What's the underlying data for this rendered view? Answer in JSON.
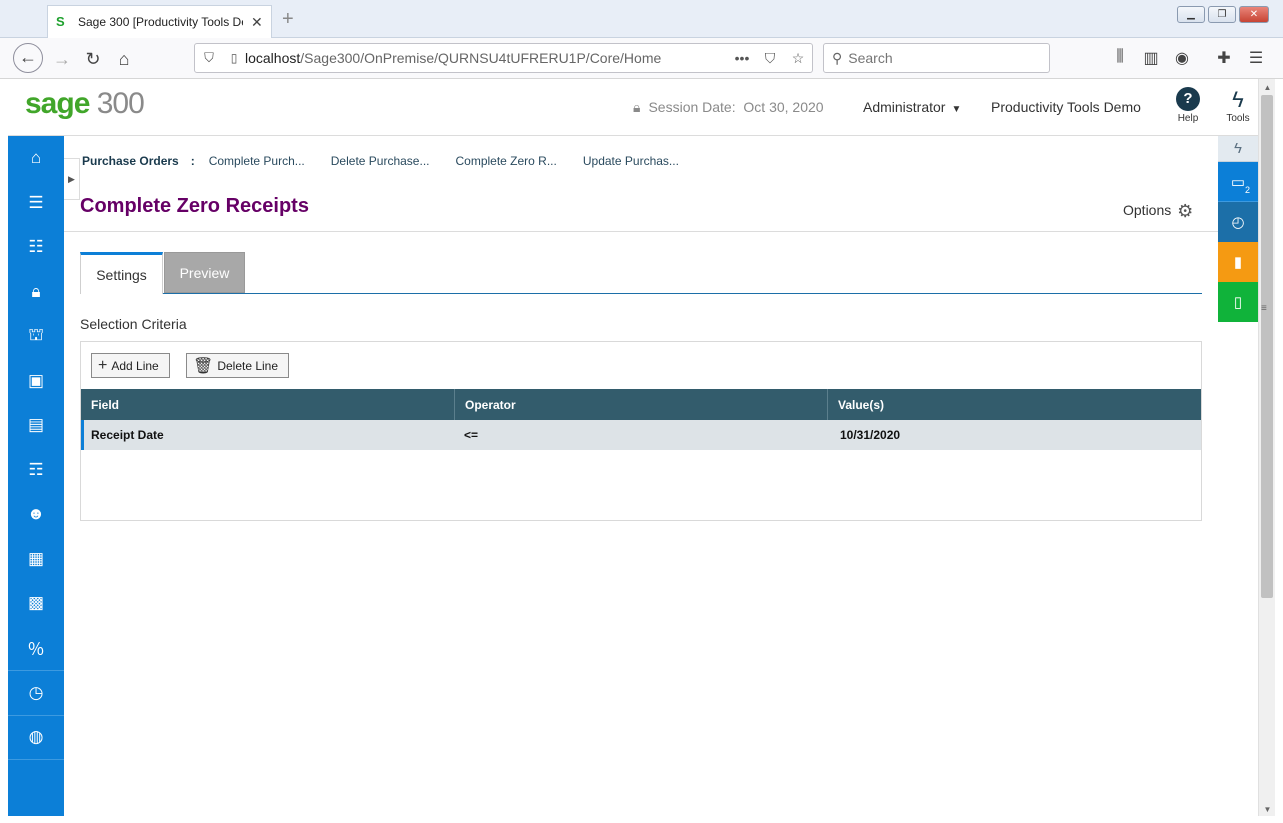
{
  "browser": {
    "tab_title": "Sage 300 [Productivity Tools De",
    "tab_favicon": "S",
    "url_host": "localhost",
    "url_path": "/Sage300/OnPremise/QURNSU4tUFRERU1P/Core/Home",
    "search_placeholder": "Search"
  },
  "header": {
    "logo_sage": "sage",
    "logo_num": "300",
    "session_label": "Session Date:",
    "session_value": "Oct 30, 2020",
    "user": "Administrator",
    "company": "Productivity Tools Demo",
    "help_label": "Help",
    "tools_label": "Tools"
  },
  "rail": {
    "window_count": "2"
  },
  "breadcrumb": {
    "root": "Purchase Orders",
    "items": [
      "Complete Purch...",
      "Delete Purchase...",
      "Complete Zero R...",
      "Update Purchas..."
    ]
  },
  "page": {
    "title": "Complete Zero Receipts",
    "options_label": "Options"
  },
  "tabs": {
    "settings": "Settings",
    "preview": "Preview"
  },
  "criteria": {
    "label": "Selection Criteria",
    "add_line": "Add Line",
    "delete_line": "Delete Line",
    "columns": [
      "Field",
      "Operator",
      "Value(s)"
    ],
    "rows": [
      {
        "field": "Receipt Date",
        "operator": "<=",
        "value": "10/31/2020"
      }
    ]
  },
  "colors": {
    "nav_blue": "#0c7fd7",
    "title_purple": "#660066",
    "grid_header": "#335c6c",
    "rail_orange": "#f59a12",
    "rail_green": "#10b33a"
  }
}
